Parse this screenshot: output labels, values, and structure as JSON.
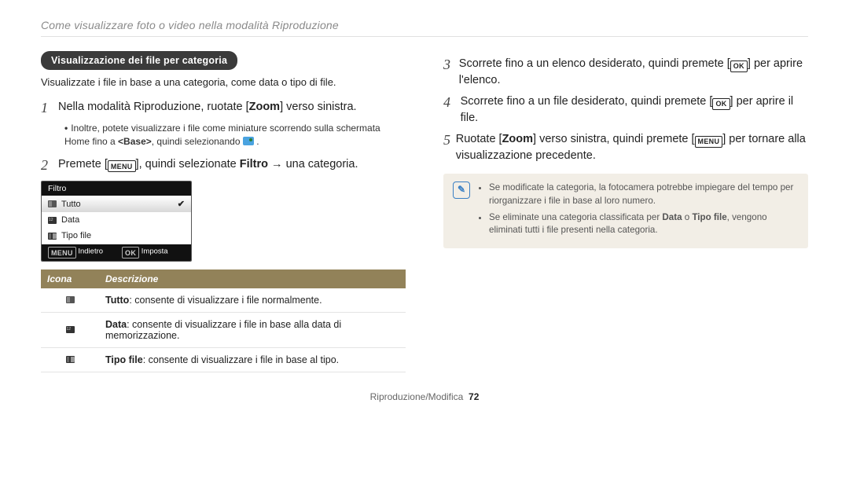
{
  "breadcrumb": "Come visualizzare foto o video nella modalità Riproduzione",
  "left": {
    "section_title": "Visualizzazione dei file per categoria",
    "lede": "Visualizzate i file in base a una categoria, come data o tipo di file.",
    "step1_pre": "Nella modalità Riproduzione, ruotate [",
    "step1_zoom": "Zoom",
    "step1_post": "] verso sinistra.",
    "bullet1_pre": "Inoltre, potete visualizzare i file come miniature scorrendo sulla schermata Home fino a ",
    "bullet1_base": "<Base>",
    "bullet1_mid": ", quindi selezionando ",
    "bullet1_post": ".",
    "step2_pre": "Premete [",
    "step2_menu": "m",
    "step2_mid": "], quindi selezionate ",
    "step2_filter": "Filtro",
    "step2_post": " → una categoria.",
    "panel": {
      "title": "Filtro",
      "r1": "Tutto",
      "r2": "Data",
      "r3": "Tipo file",
      "back": "Indietro",
      "set": "Imposta"
    },
    "table": {
      "h1": "Icona",
      "h2": "Descrizione",
      "d1a": "Tutto",
      "d1b": ": consente di visualizzare i file normalmente.",
      "d2a": "Data",
      "d2b": ": consente di visualizzare i file in base alla data di memorizzazione.",
      "d3a": "Tipo file",
      "d3b": ": consente di visualizzare i file in base al tipo."
    }
  },
  "right": {
    "s3_pre": "Scorrete fino a un elenco desiderato, quindi premete [",
    "s3_ok": "o",
    "s3_post": "] per aprire l'elenco.",
    "s4_pre": "Scorrete fino a un file desiderato, quindi premete [",
    "s4_ok": "o",
    "s4_post": "] per aprire il file.",
    "s5_pre": "Ruotate [",
    "s5_zoom": "Zoom",
    "s5_mid": "] verso sinistra, quindi premete [",
    "s5_menu": "m",
    "s5_post": "] per tornare alla visualizzazione precedente.",
    "note1": "Se modificate la categoria, la fotocamera potrebbe impiegare del tempo per riorganizzare i file in base al loro numero.",
    "note2_a": "Se eliminate una categoria classificata per ",
    "note2_b": "Data",
    "note2_c": " o ",
    "note2_d": "Tipo file",
    "note2_e": ", vengono eliminati tutti i file presenti nella categoria."
  },
  "footer": {
    "section": "Riproduzione/Modifica",
    "page": "72"
  },
  "iconlabels": {
    "menu": "MENU",
    "ok": "OK"
  }
}
